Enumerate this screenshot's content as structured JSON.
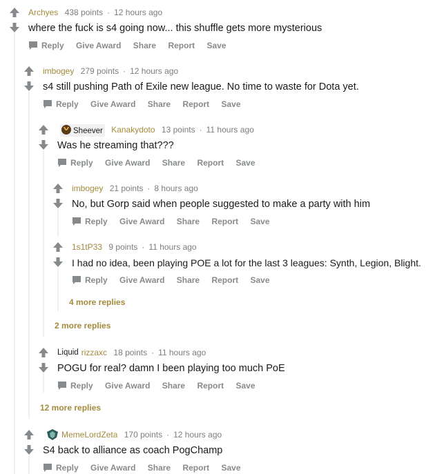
{
  "actions": {
    "reply": "Reply",
    "give_award": "Give Award",
    "share": "Share",
    "report": "Report",
    "save": "Save"
  },
  "colors": {
    "username": "#a48a3c",
    "meta": "#7c7c7c",
    "action": "#878a8c",
    "thread_line": "#edeff1",
    "vote_arrow": "#878a8c"
  },
  "comments": [
    {
      "author": "Archyes",
      "points": "438 points",
      "time": "12 hours ago",
      "text": "where the fuck is s4 going now... this shuffle gets more mysterious"
    },
    {
      "author": "imbogey",
      "points": "279 points",
      "time": "12 hours ago",
      "text": "s4 still pushing Path of Exile new league. No time to waste for Dota yet."
    },
    {
      "flair": "Sheever",
      "flair_icon": "sheever-flair-icon",
      "author": "Kanakydoto",
      "points": "13 points",
      "time": "11 hours ago",
      "text": "Was he streaming that???"
    },
    {
      "author": "imbogey",
      "points": "21 points",
      "time": "8 hours ago",
      "text": "No, but Gorp said when people suggested to make a party with him"
    },
    {
      "author": "1s1tP33",
      "points": "9 points",
      "time": "11 hours ago",
      "text": "I had no idea, been playing POE a lot for the last 3 leagues: Synth, Legion, Blight."
    },
    {
      "flair": "Liquid",
      "author": "rizzaxc",
      "points": "18 points",
      "time": "11 hours ago",
      "text": "POGU for real? damn I been playing too much PoE"
    },
    {
      "flair_icon": "team-emblem-icon",
      "author": "MemeLordZeta",
      "points": "170 points",
      "time": "12 hours ago",
      "text": "S4 back to alliance as coach PogChamp"
    }
  ],
  "more_replies": [
    "4 more replies",
    "2 more replies",
    "12 more replies"
  ]
}
